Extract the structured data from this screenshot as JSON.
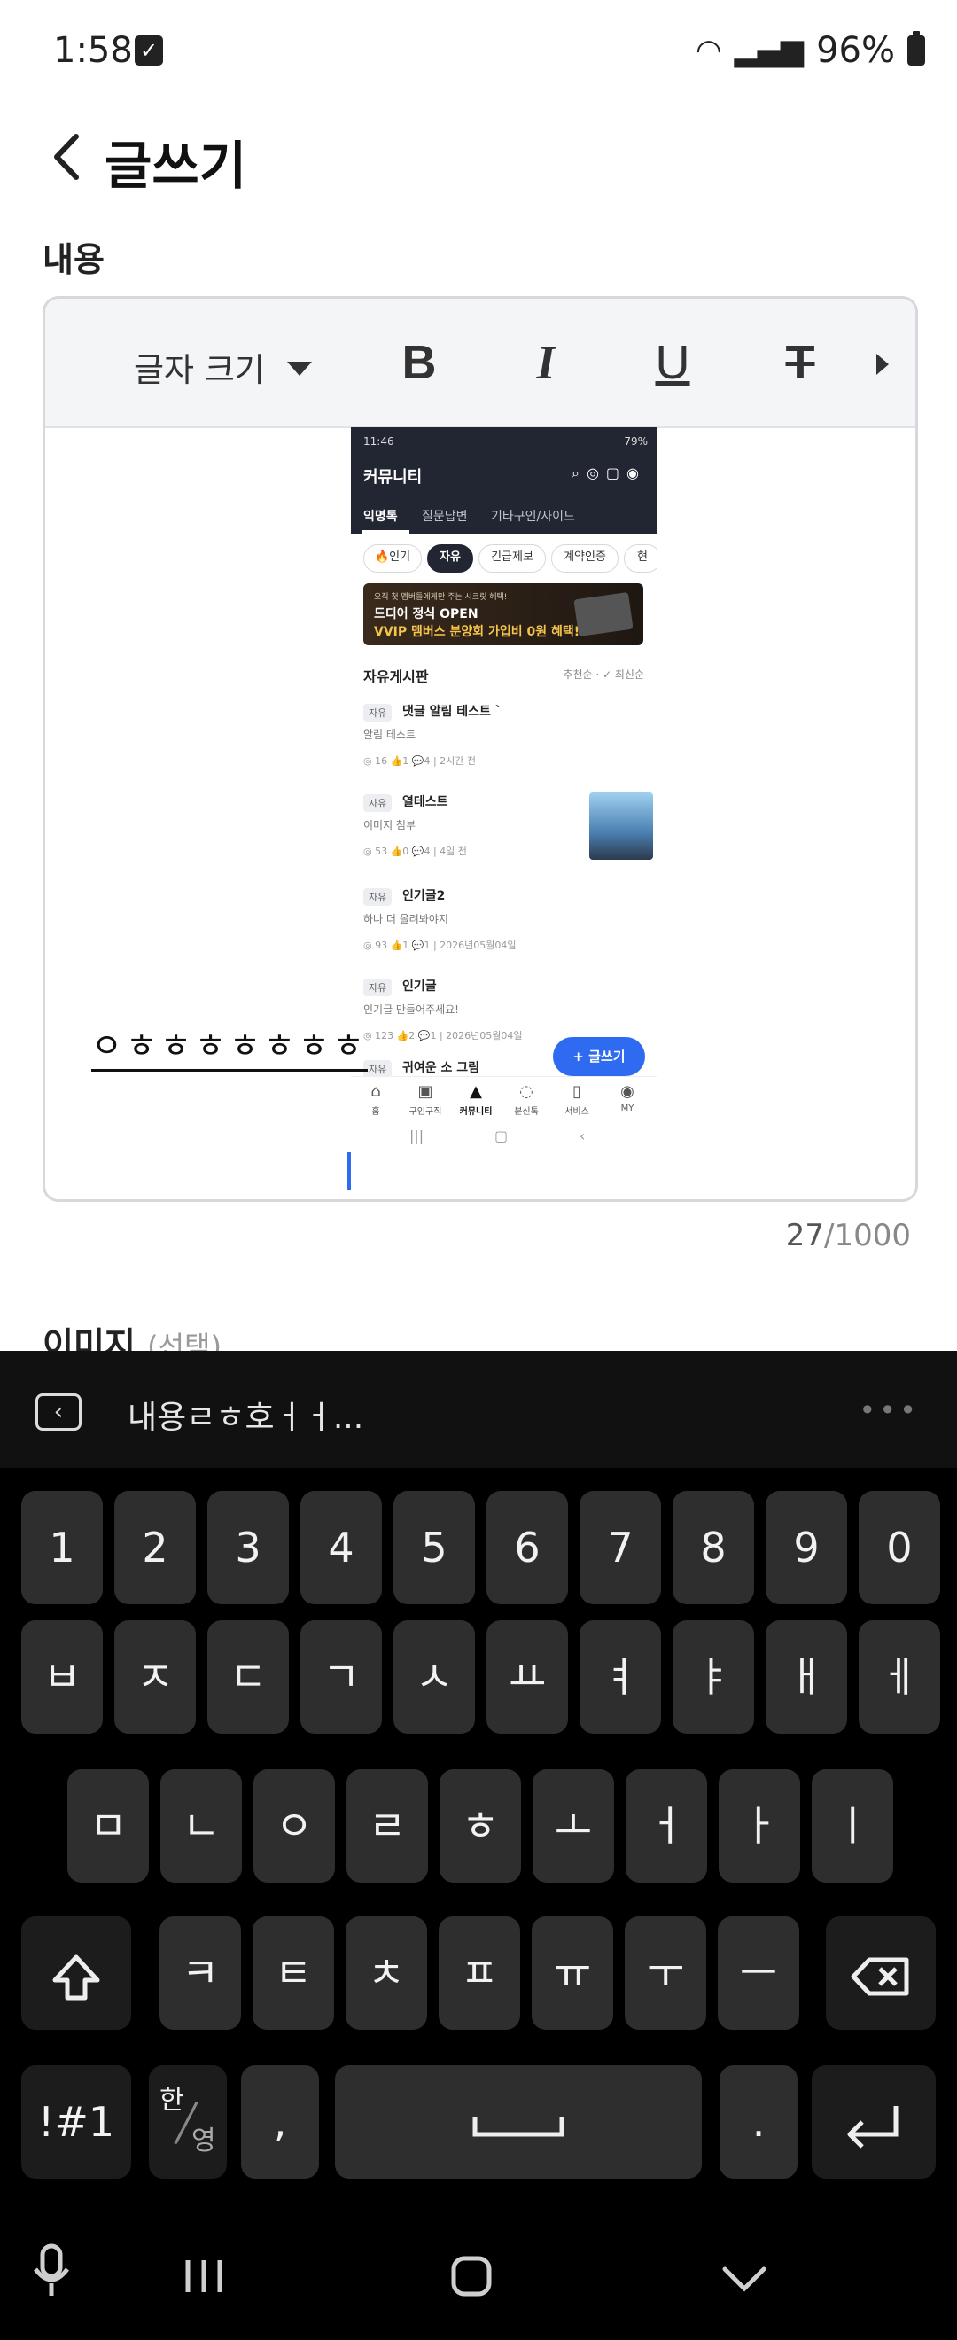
{
  "status": {
    "time": "1:58",
    "battery": "96%"
  },
  "header": {
    "title": "글쓰기",
    "section": "내용"
  },
  "toolbar": {
    "font_size": "글자 크기",
    "bold": "B",
    "italic": "I",
    "underline": "U",
    "strike": "T"
  },
  "embedded": {
    "time": "11:46",
    "battery": "79%",
    "title": "커뮤니티",
    "tabs": [
      "익명톡",
      "질문답변",
      "기타구인/사이드"
    ],
    "chips": [
      "🔥인기",
      "자유",
      "긴급제보",
      "계약인증",
      "현"
    ],
    "banner": {
      "small": "오직 첫 멤버들에게만 주는 시크릿 혜택!",
      "line1": "드디어 정식 OPEN",
      "line2": "VVIP 멤버스 분양회 가입비 0원 혜택!"
    },
    "board_title": "자유게시판",
    "sort": "추천순 · ✓ 최신순",
    "posts": [
      {
        "tag": "자유",
        "title": "댓글 알림 테스트 `",
        "sub": "알림 테스트",
        "meta": "◎ 16  👍1  💬4  |  2시간 전"
      },
      {
        "tag": "자유",
        "title": "열테스트",
        "sub": "이미지 첨부",
        "meta": "◎ 53  👍0  💬4  |  4일 전"
      },
      {
        "tag": "자유",
        "title": "인기글2",
        "sub": "하나 더 올려봐야지",
        "meta": "◎ 93  👍1  💬1  |  2026년05월04일"
      },
      {
        "tag": "자유",
        "title": "인기글",
        "sub": "인기글 만들어주세요!",
        "meta": "◎ 123  👍2  💬1  |  2026년05월04일"
      },
      {
        "tag": "자유",
        "title": "귀여운 소 그림",
        "sub": "",
        "meta": ""
      }
    ],
    "fab": "+ 글쓰기",
    "nav": [
      "홈",
      "구인구직",
      "커뮤니티",
      "분신톡",
      "서비스",
      "MY"
    ]
  },
  "editor_text": "ㅇㅎㅎㅎㅎㅎㅎㅎ",
  "counter": {
    "current": "27",
    "max": "/1000"
  },
  "image_section": {
    "label": "이미지",
    "optional": "(선택)"
  },
  "keyboard": {
    "suggestion": "내용ㄹㅎ호ㅓㅓ...",
    "row1": [
      "1",
      "2",
      "3",
      "4",
      "5",
      "6",
      "7",
      "8",
      "9",
      "0"
    ],
    "row2": [
      "ㅂ",
      "ㅈ",
      "ㄷ",
      "ㄱ",
      "ㅅ",
      "ㅛ",
      "ㅕ",
      "ㅑ",
      "ㅐ",
      "ㅔ"
    ],
    "row3": [
      "ㅁ",
      "ㄴ",
      "ㅇ",
      "ㄹ",
      "ㅎ",
      "ㅗ",
      "ㅓ",
      "ㅏ",
      "ㅣ"
    ],
    "row4": [
      "ㅋ",
      "ㅌ",
      "ㅊ",
      "ㅍ",
      "ㅠ",
      "ㅜ",
      "ㅡ"
    ],
    "symbols": "!#1",
    "lang_top": "한",
    "lang_bottom": "영",
    "comma": ",",
    "period": "."
  }
}
